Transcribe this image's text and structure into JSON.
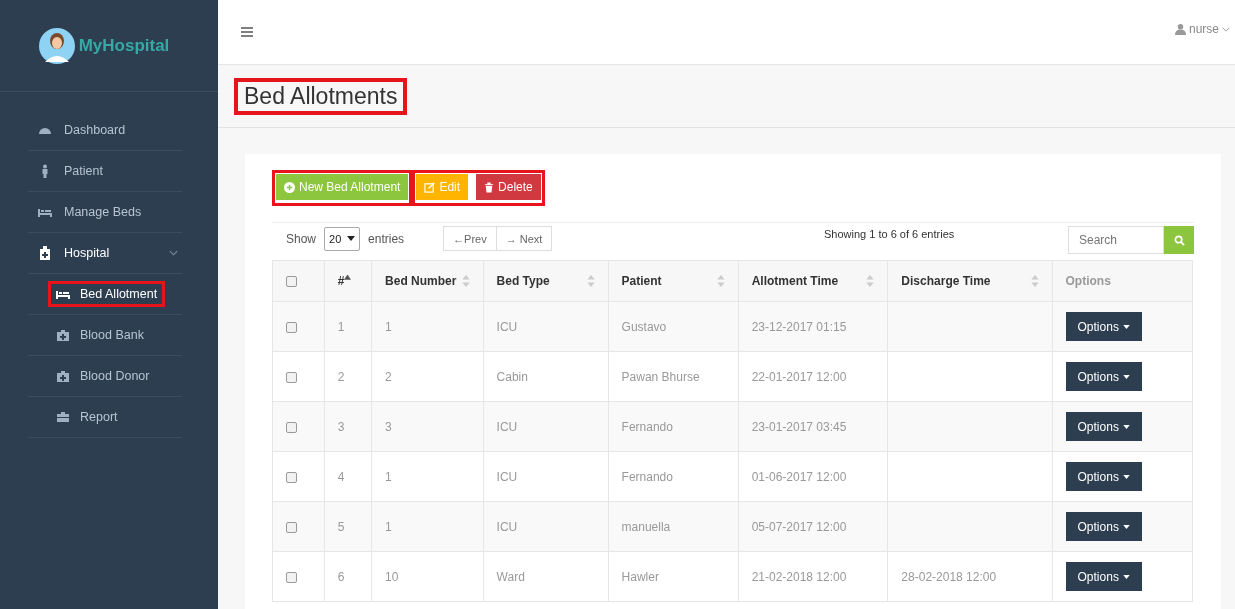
{
  "brand": {
    "name": "MyHospital"
  },
  "sidebar": {
    "items": [
      {
        "label": "Dashboard",
        "expanded": false
      },
      {
        "label": "Patient",
        "expanded": false
      },
      {
        "label": "Manage Beds",
        "expanded": false
      },
      {
        "label": "Hospital",
        "expanded": true,
        "children": [
          {
            "label": "Bed Allotment",
            "selected": true,
            "annotated": true
          },
          {
            "label": "Blood Bank",
            "selected": false,
            "annotated": false
          },
          {
            "label": "Blood Donor",
            "selected": false,
            "annotated": false
          },
          {
            "label": "Report",
            "selected": false,
            "annotated": false
          }
        ]
      }
    ]
  },
  "header": {
    "user": "nurse"
  },
  "page_title": {
    "text": "Bed Allotments",
    "annotated": true
  },
  "toolbar": {
    "groups": [
      {
        "annotated": true,
        "buttons": [
          {
            "label": "New Bed Allotment",
            "kind": "add"
          }
        ]
      },
      {
        "annotated": true,
        "buttons": [
          {
            "label": "Edit",
            "kind": "edit"
          },
          {
            "label": "Delete",
            "kind": "delete"
          }
        ]
      }
    ]
  },
  "table_controls": {
    "show_label": "Show",
    "page_size": "20",
    "entries_label": "entries",
    "prev": "←Prev",
    "next": "→ Next",
    "info": "Showing 1 to 6 of 6 entries",
    "search_placeholder": "Search"
  },
  "table": {
    "select_all_checked": false,
    "columns": [
      {
        "label": "#",
        "sortable": true,
        "sorted_ascending": true
      },
      {
        "label": "Bed Number",
        "sortable": true,
        "sorted_ascending": false
      },
      {
        "label": "Bed Type",
        "sortable": true,
        "sorted_ascending": false
      },
      {
        "label": "Patient",
        "sortable": true,
        "sorted_ascending": false
      },
      {
        "label": "Allotment Time",
        "sortable": true,
        "sorted_ascending": false
      },
      {
        "label": "Discharge Time",
        "sortable": true,
        "sorted_ascending": false
      },
      {
        "label": "Options",
        "sortable": false,
        "sorted_ascending": false
      }
    ],
    "rows": [
      {
        "checked": false,
        "cells": [
          "1",
          "1",
          "ICU",
          "Gustavo",
          "23-12-2017 01:15",
          ""
        ],
        "action": "Options"
      },
      {
        "checked": false,
        "cells": [
          "2",
          "2",
          "Cabin",
          "Pawan Bhurse",
          "22-01-2017 12:00",
          ""
        ],
        "action": "Options"
      },
      {
        "checked": false,
        "cells": [
          "3",
          "3",
          "ICU",
          "Fernando",
          "23-01-2017 03:45",
          ""
        ],
        "action": "Options"
      },
      {
        "checked": false,
        "cells": [
          "4",
          "1",
          "ICU",
          "Fernando",
          "01-06-2017 12:00",
          ""
        ],
        "action": "Options"
      },
      {
        "checked": false,
        "cells": [
          "5",
          "1",
          "ICU",
          "manuella",
          "05-07-2017 12:00",
          ""
        ],
        "action": "Options"
      },
      {
        "checked": false,
        "cells": [
          "6",
          "10",
          "Ward",
          "Hawler",
          "21-02-2018 12:00",
          "28-02-2018 12:00"
        ],
        "action": "Options"
      }
    ]
  }
}
